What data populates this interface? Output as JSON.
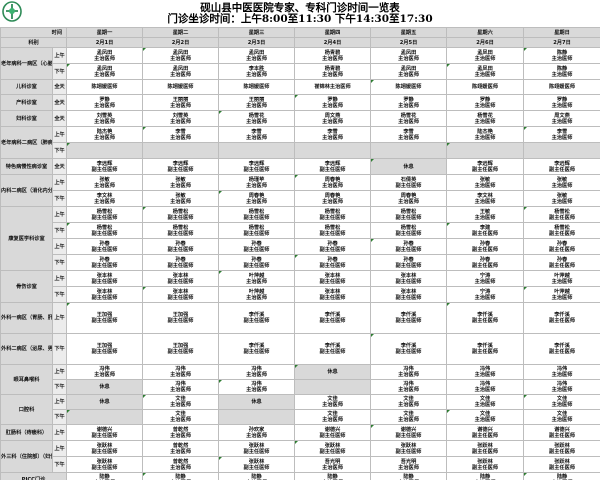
{
  "title": "砚山县中医医院专家、专科门诊时间一览表",
  "subtitle": "门诊坐诊时间：上午8:00至11:30  下午14:30至17:30",
  "header": {
    "time": "时间",
    "dept": "科别",
    "days": [
      "星期一",
      "星期二",
      "星期三",
      "星期四",
      "星期五",
      "星期六",
      "星期日"
    ],
    "dates": [
      "2月1日",
      "2月2日",
      "2月3日",
      "2月4日",
      "2月5日",
      "2月6日",
      "2月7日"
    ]
  },
  "logo": {
    "icon": "hospital-logo-icon",
    "color": "#2e8b57"
  },
  "rows": [
    {
      "dept": "老年病科一病区（心脑病）",
      "dspan": 2,
      "period": "上午",
      "cells": [
        "孟凤田\n主治医师",
        "孟凤田\n主治医师",
        "孟凤田\n主治医师",
        "杨青碧\n主治医师",
        "孟凤田\n主治医师",
        "孟凤田\n主治医师",
        "陈静\n主治医师"
      ]
    },
    {
      "period": "下午",
      "cells": [
        "孟凤田\n主治医师",
        "孟凤田\n主治医师",
        "李本胜\n主治医师",
        "杨青碧\n主治医师",
        "孟凤田\n主治医师",
        "孟凤田\n主治医师",
        "陈静\n主治医师"
      ]
    },
    {
      "dept": "儿科诊室",
      "dspan": 1,
      "period": "全天",
      "cells": [
        "陈翊媛医师",
        "陈翊媛医师",
        "陈翊媛医师",
        "崔锦林主治医师",
        "陈翊媛医师",
        "陈翊媛医师",
        "陈翊媛医师"
      ]
    },
    {
      "dept": "产科诊室",
      "dspan": 1,
      "period": "全天",
      "cells": [
        "罗静\n主治医师",
        "王丽丽\n主治医师",
        "王丽丽\n主治医师",
        "罗静\n主治医师",
        "罗静\n主治医师",
        "罗静\n主治医师",
        "罗静\n主治医师"
      ]
    },
    {
      "dept": "妇科诊室",
      "dspan": 1,
      "period": "全天",
      "cells": [
        "刘雪英\n主治医师",
        "刘雪英\n主治医师",
        "杨雪花\n主治医师",
        "周文燕\n主治医师",
        "杨雪花\n主治医师",
        "杨雪花\n主治医师",
        "周文燕\n主治医师"
      ]
    },
    {
      "dept": "老年病科二病区（肺病）",
      "dspan": 2,
      "period": "上午",
      "cells": [
        "陆杰艳\n主治医师",
        "李雪\n主治医师",
        "李雪\n主治医师",
        "李雪\n主治医师",
        "李雪\n主治医师",
        "陆杰艳\n主治医师",
        "李雪\n主治医师"
      ]
    },
    {
      "period": "下午",
      "cells": [
        "",
        "",
        "",
        "",
        "",
        "",
        ""
      ]
    },
    {
      "dept": "特色病慢性病诊室",
      "dspan": 1,
      "period": "全天",
      "cells": [
        "李远辉\n副主任医师",
        "李远辉\n副主任医师",
        "李远辉\n副主任医师",
        "李远辉\n副主任医师",
        "休息",
        "李远辉\n副主任医师",
        "李远辉\n副主任医师"
      ]
    },
    {
      "dept": "内科二病区（消化内分泌）诊室",
      "dspan": 2,
      "period": "上午",
      "cells": [
        "张敏\n主治医师",
        "张敏\n主治医师",
        "杨瑾苹\n主治医师",
        "周春艳\n主治医师",
        "石倩英\n副主任医师",
        "张敏\n主治医师",
        "张敏\n主治医师"
      ]
    },
    {
      "period": "下午",
      "cells": [
        "李文林\n主治医师",
        "张敏\n主治医师",
        "周春艳\n主治医师",
        "周春艳\n主治医师",
        "周春艳\n主治医师",
        "李文林\n主治医师",
        "张敏\n主治医师"
      ]
    },
    {
      "dept": "康复医学科诊室",
      "dspan": 4,
      "period": "上午",
      "cells": [
        "杨雪松\n副主任医师",
        "杨雪松\n副主任医师",
        "杨雪松\n副主任医师",
        "杨雪松\n副主任医师",
        "杨雪松\n副主任医师",
        "王敏\n主治医师",
        "杨雪松\n副主任医师"
      ]
    },
    {
      "period": "下午",
      "cells": [
        "杨雪松\n副主任医师",
        "杨雪松\n副主任医师",
        "杨雪松\n副主任医师",
        "杨雪松\n副主任医师",
        "杨雪松\n副主任医师",
        "李建\n副主任医师",
        "杨雪松\n副主任医师"
      ]
    },
    {
      "period": "上午",
      "cells": [
        "孙春\n副主任医师",
        "孙春\n副主任医师",
        "孙春\n副主任医师",
        "孙春\n副主任医师",
        "孙春\n副主任医师",
        "孙春\n副主任医师",
        "孙春\n副主任医师"
      ]
    },
    {
      "period": "下午",
      "cells": [
        "孙春\n副主任医师",
        "孙春\n副主任医师",
        "孙春\n副主任医师",
        "孙春\n副主任医师",
        "孙春\n副主任医师",
        "孙春\n副主任医师",
        "孙春\n副主任医师"
      ]
    },
    {
      "dept": "骨伤诊室",
      "dspan": 2,
      "period": "上午",
      "cells": [
        "张本林\n副主任医师",
        "张本林\n副主任医师",
        "叶萍越\n主治医师",
        "张本林\n副主任医师",
        "张本林\n副主任医师",
        "宁涛\n主治医师",
        "叶萍越\n主治医师"
      ]
    },
    {
      "period": "下午",
      "cells": [
        "张本林\n副主任医师",
        "张本林\n副主任医师",
        "叶萍越\n主治医师",
        "张本林\n副主任医师",
        "张本林\n副主任医师",
        "宁涛\n主治医师",
        "叶萍越\n主治医师"
      ]
    },
    {
      "dept": "外科一病区（胃肠、肝胆、脑血）",
      "dspan": 1,
      "period": "上午",
      "cells": [
        "王加强\n副主任医师",
        "王加强\n副主任医师",
        "李仟溪\n副主任医师",
        "李仟溪\n副主任医师",
        "李仟溪\n副主任医师",
        "李仟溪\n副主任医师",
        "李仟溪\n副主任医师"
      ]
    },
    {
      "dept": "外科二病区（泌尿、男性病）",
      "dspan": 1,
      "period": "下午",
      "cells": [
        "王加强\n副主任医师",
        "王加强\n副主任医师",
        "李仟溪\n副主任医师",
        "李仟溪\n副主任医师",
        "李仟溪\n副主任医师",
        "李仟溪\n副主任医师",
        "李仟溪\n副主任医师"
      ]
    },
    {
      "dept": "眼耳鼻喉科",
      "dspan": 2,
      "period": "上午",
      "cells": [
        "冯伟\n主治医师",
        "冯伟\n主治医师",
        "冯伟\n主治医师",
        "休息",
        "冯伟\n主治医师",
        "冯伟\n主治医师",
        "冯伟\n主治医师"
      ]
    },
    {
      "period": "下午",
      "cells": [
        "休息",
        "冯伟\n主治医师",
        "冯伟\n主治医师",
        "",
        "冯伟\n主治医师",
        "冯伟\n主治医师",
        "冯伟\n主治医师"
      ]
    },
    {
      "dept": "口腔科",
      "dspan": 2,
      "period": "上午",
      "cells": [
        "休息",
        "文佳\n主治医师",
        "休息",
        "文佳\n主治医师",
        "文佳\n主治医师",
        "文佳\n主治医师",
        "文佳\n主治医师"
      ]
    },
    {
      "period": "下午",
      "cells": [
        "",
        "文佳\n主治医师",
        "",
        "文佳\n主治医师",
        "文佳\n主治医师",
        "文佳\n主治医师",
        "文佳\n主治医师"
      ]
    },
    {
      "dept": "肛肠科（痔瘘科）",
      "dspan": 1,
      "period": "上午",
      "cells": [
        "谢德兴\n副主任医师",
        "曾乾然\n主治医师",
        "孙欢家\n主治医师",
        "谢德兴\n副主任医师",
        "谢德兴\n副主任医师",
        "谢德兴\n副主任医师",
        "谢德兴\n副主任医师"
      ]
    },
    {
      "dept": "外三科（住院部）（妇伤、外伤、外科）",
      "dspan": 2,
      "period": "上午",
      "cells": [
        "张跃林\n副主任医师",
        "曾乾然\n主治医师",
        "张跃林\n副主任医师",
        "张跃林\n副主任医师",
        "张跃林\n副主任医师",
        "张跃林\n副主任医师",
        "张跃林\n副主任医师"
      ]
    },
    {
      "period": "下午",
      "cells": [
        "张跃林\n副主任医师",
        "曾乾然\n主治医师",
        "张跃林\n副主任医师",
        "吾光明\n主治医师",
        "吾光明\n主治医师",
        "张跃林\n副主任医师",
        "张跃林\n副主任医师"
      ]
    },
    {
      "dept": "PICC门诊",
      "dspan": 1,
      "period": "",
      "cells": [
        "陆静\n主治医师",
        "陆静\n主治医师",
        "陆静\n主治医师",
        "陆静\n主治医师",
        "陆静\n主治医师",
        "陆静\n主治医师",
        "陆静\n主治医师"
      ]
    }
  ]
}
